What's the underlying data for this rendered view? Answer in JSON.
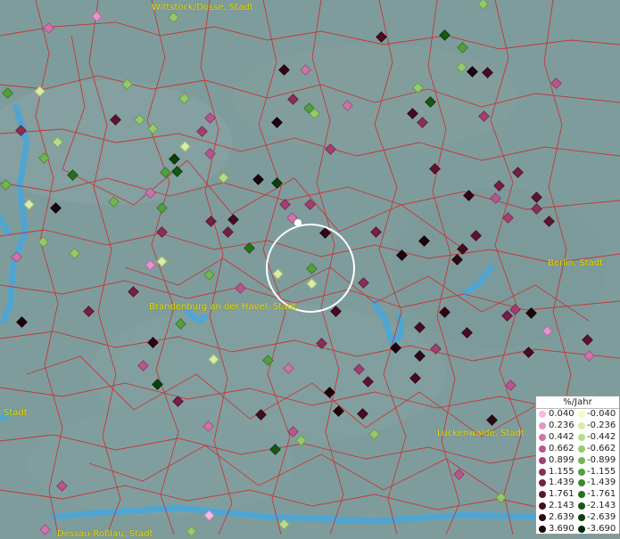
{
  "map": {
    "background_color": "#7f9c9c",
    "boundary_color": "#d02626",
    "water_color": "#4aa6d8",
    "cities": [
      {
        "name": "Wittstock/Dosse, Stadt"
      },
      {
        "name": "Brandenburg an der Havel, Stadt"
      },
      {
        "name": "Berlin, Stadt"
      },
      {
        "name": "Luckenwalde, Stadt"
      },
      {
        "name": "Stadt"
      },
      {
        "name": "Dessau-Roßlau, Stadt"
      }
    ]
  },
  "legend": {
    "title": "%/Jahr",
    "positive": [
      {
        "label": "0.040",
        "color": "#f7b8e6"
      },
      {
        "label": "0.236",
        "color": "#e394cb"
      },
      {
        "label": "0.442",
        "color": "#cf73ad"
      },
      {
        "label": "0.662",
        "color": "#b85690"
      },
      {
        "label": "0.899",
        "color": "#a04072"
      },
      {
        "label": "1.155",
        "color": "#8a2e58"
      },
      {
        "label": "1.439",
        "color": "#741f43"
      },
      {
        "label": "1.761",
        "color": "#5c1430"
      },
      {
        "label": "2.143",
        "color": "#460c21"
      },
      {
        "label": "2.639",
        "color": "#300615"
      },
      {
        "label": "3.690",
        "color": "#1c020b"
      }
    ],
    "negative": [
      {
        "label": "-0.040",
        "color": "#f3fbc4"
      },
      {
        "label": "-0.236",
        "color": "#d6eea4"
      },
      {
        "label": "-0.442",
        "color": "#b6de88"
      },
      {
        "label": "-0.662",
        "color": "#93cb6c"
      },
      {
        "label": "-0.899",
        "color": "#72b652"
      },
      {
        "label": "-1.155",
        "color": "#52a03c"
      },
      {
        "label": "-1.439",
        "color": "#3a892b"
      },
      {
        "label": "-1.761",
        "color": "#266f1e"
      },
      {
        "label": "-2.143",
        "color": "#175614"
      },
      {
        "label": "-2.639",
        "color": "#0c3f0c"
      },
      {
        "label": "-3.690",
        "color": "#052905"
      }
    ]
  }
}
